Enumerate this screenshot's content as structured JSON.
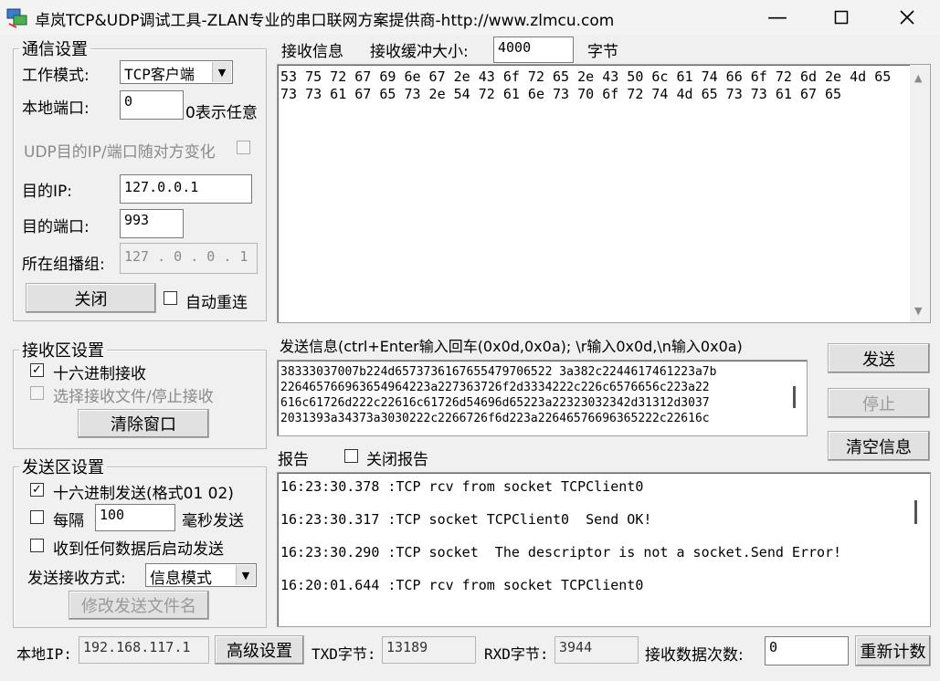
{
  "window": {
    "title": "卓岚TCP&UDP调试工具-ZLAN专业的串口联网方案提供商-http://www.zlmcu.com"
  },
  "comm": {
    "legend": "通信设置",
    "mode_label": "工作模式:",
    "mode_value": "TCP客户端",
    "local_port_label": "本地端口:",
    "local_port_value": "0",
    "local_port_hint": "0表示任意",
    "udp_follow_label": "UDP目的IP/端口随对方变化",
    "dest_ip_label": "目的IP:",
    "dest_ip_value": "127.0.0.1",
    "dest_port_label": "目的端口:",
    "dest_port_value": "993",
    "multicast_label": "所在组播组:",
    "multicast_value": "127 . 0  . 0  . 1",
    "close_button": "关闭",
    "auto_reconnect_label": "自动重连"
  },
  "recv_settings": {
    "legend": "接收区设置",
    "hex_recv_label": "十六进制接收",
    "select_file_label": "选择接收文件/停止接收",
    "clear_button": "清除窗口"
  },
  "send_settings": {
    "legend": "发送区设置",
    "hex_send_label": "十六进制发送(格式01 02)",
    "every_label": "每隔",
    "interval_value": "100",
    "interval_unit": "毫秒发送",
    "send_after_recv_label": "收到任何数据后启动发送",
    "mode_label": "发送接收方式:",
    "mode_value": "信息模式",
    "change_file_button": "修改发送文件名"
  },
  "recv": {
    "title": "接收信息",
    "buffer_label": "接收缓冲大小:",
    "buffer_value": "4000",
    "buffer_unit": "字节",
    "line1": "53 75 72 67 69 6e 67 2e 43 6f 72 65 2e 43 50 6c 61 74 66 6f 72 6d 2e 4d 65",
    "line2": "73 73 61 67 65 73 2e 54 72 61 6e 73 70 6f 72 74 4d 65 73 73 61 67 65"
  },
  "send": {
    "title": "发送信息(ctrl+Enter输入回车(0x0d,0x0a); \\r输入0x0d,\\n输入0x0a)",
    "line1": "38333037007b224d6573736167655479706522 3a382c2244617461223a7b",
    "line2": "226465766963654964223a227363726f2d3334222c226c6576656c223a22",
    "line3": "616c61726d222c22616c61726d54696d65223a22323032342d31312d3037",
    "line4": "2031393a34373a3030222c2266726f6d223a22646576696365222c22616c",
    "send_button": "发送",
    "stop_button": "停止",
    "clear_button": "清空信息"
  },
  "report": {
    "title": "报告",
    "close_report_label": "关闭报告",
    "lines": [
      "16:23:30.378 :TCP rcv from socket TCPClient0",
      "16:23:30.317 :TCP socket TCPClient0  Send OK!",
      "16:23:30.290 :TCP socket  The descriptor is not a socket.Send Error!",
      "16:20:01.644 :TCP rcv from socket TCPClient0"
    ]
  },
  "status": {
    "local_ip_label": "本地IP:",
    "local_ip_value": "192.168.117.1",
    "advanced_button": "高级设置",
    "txd_label": "TXD字节:",
    "txd_value": "13189",
    "rxd_label": "RXD字节:",
    "rxd_value": "3944",
    "recv_count_label": "接收数据次数:",
    "recv_count_value": "0",
    "recount_button": "重新计数"
  }
}
